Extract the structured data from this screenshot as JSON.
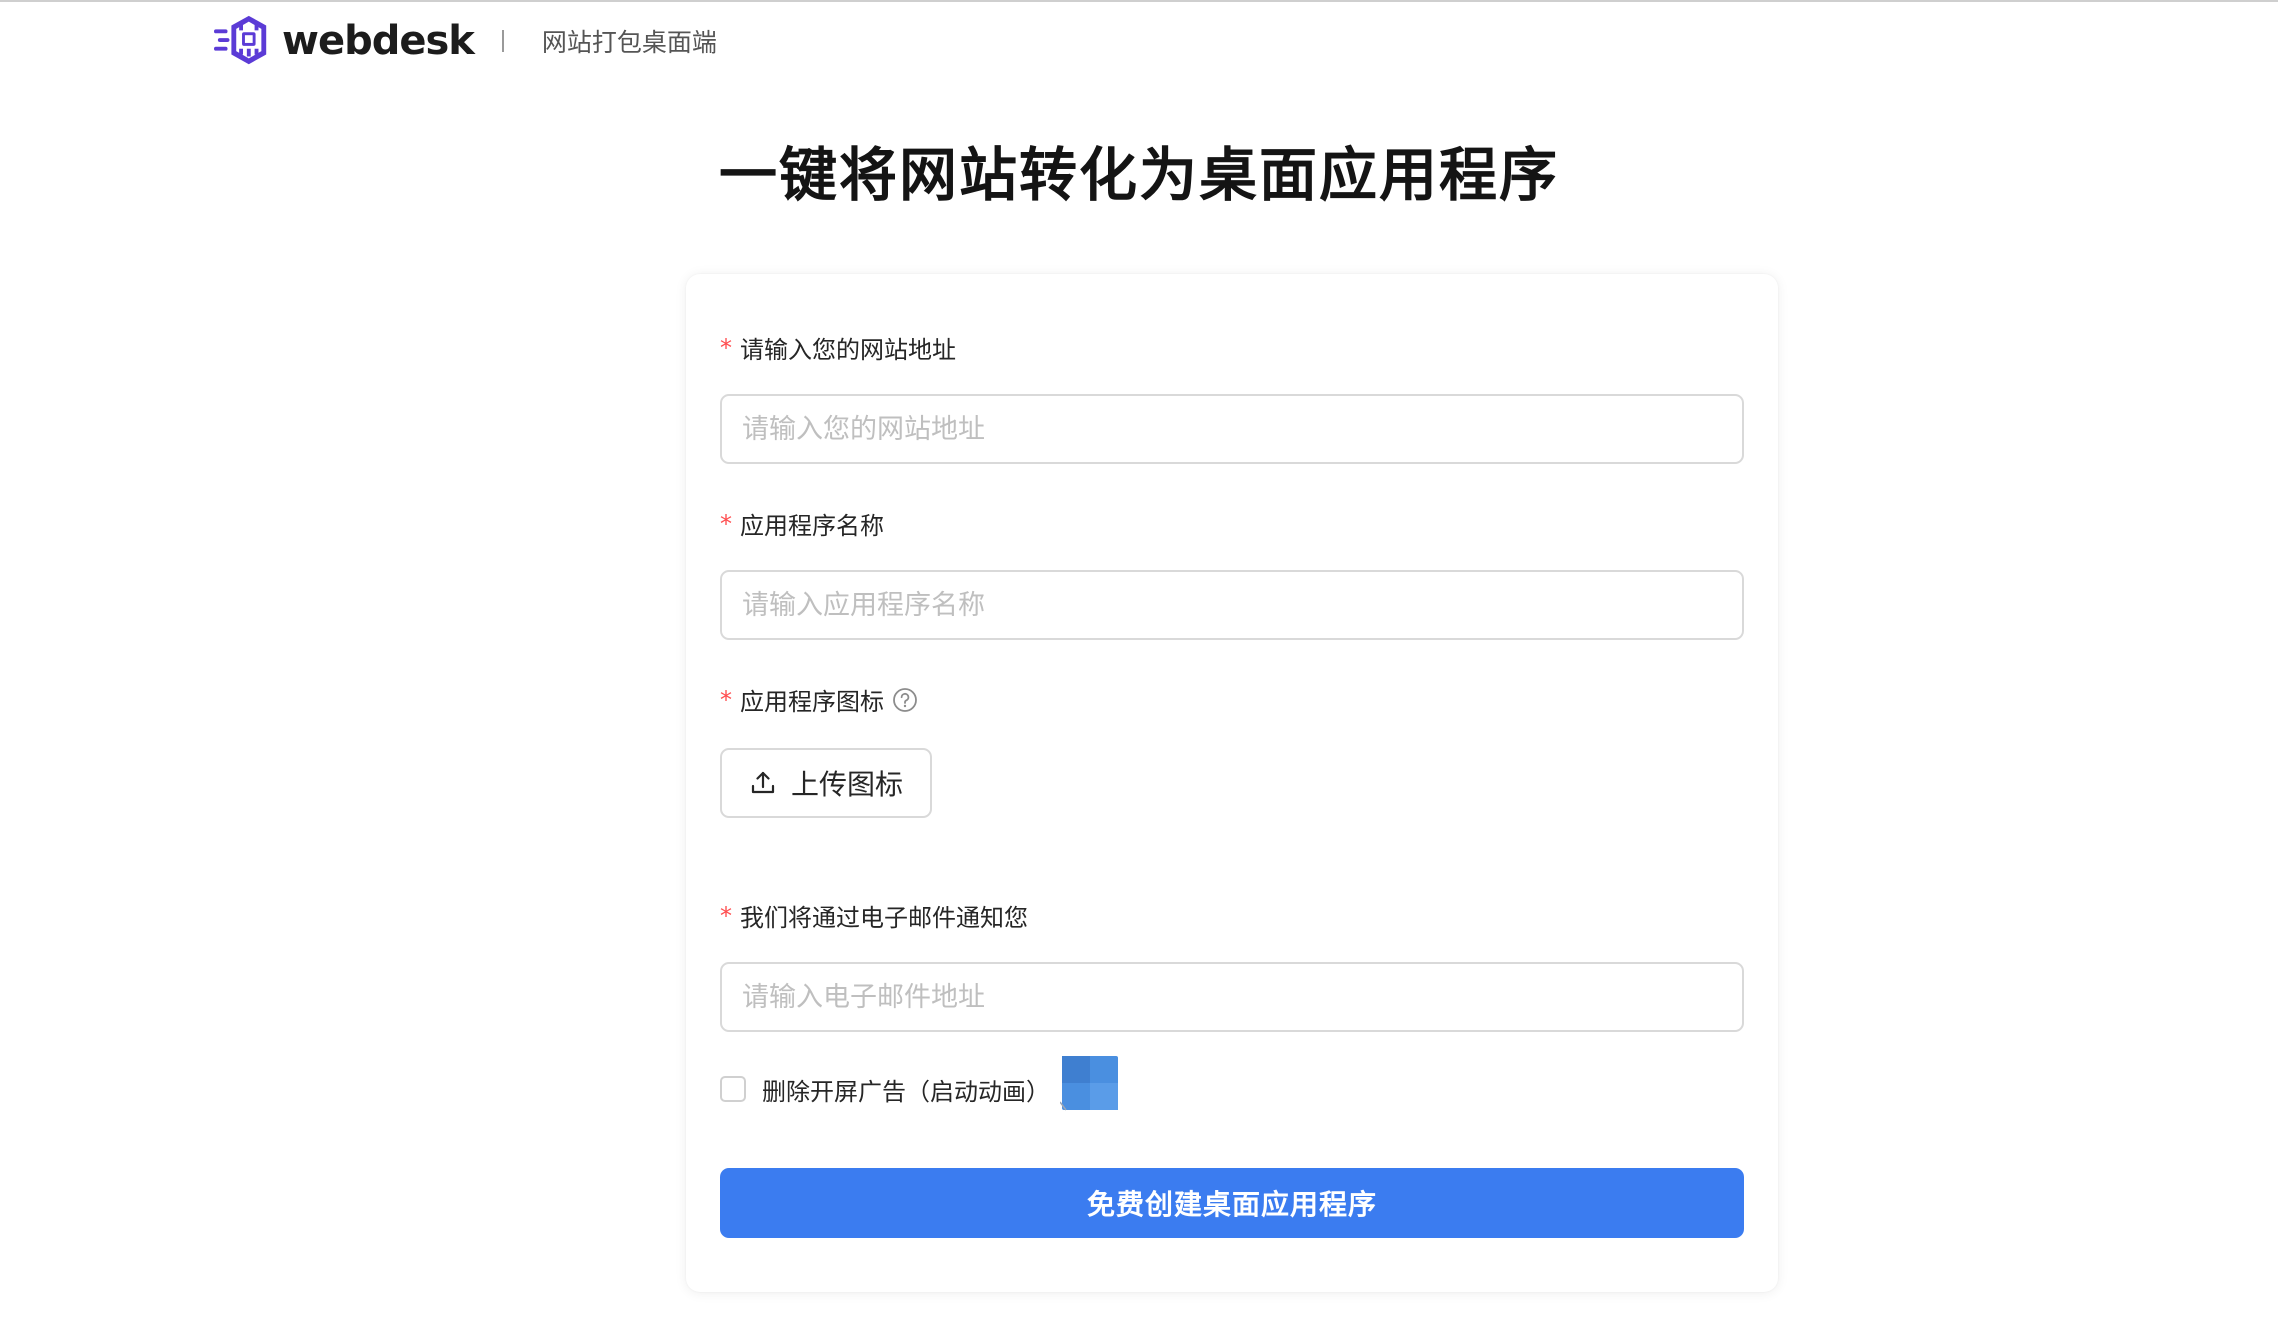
{
  "header": {
    "logo_text": "webdesk",
    "tagline": "网站打包桌面端"
  },
  "headline": "一键将网站转化为桌面应用程序",
  "form": {
    "required_mark": "*",
    "website": {
      "label": "请输入您的网站地址",
      "placeholder": "请输入您的网站地址",
      "value": ""
    },
    "app_name": {
      "label": "应用程序名称",
      "placeholder": "请输入应用程序名称",
      "value": ""
    },
    "app_icon": {
      "label": "应用程序图标",
      "help_icon": "question-circle-icon",
      "upload_label": "上传图标",
      "upload_icon": "upload-icon"
    },
    "email": {
      "label": "我们将通过电子邮件通知您",
      "placeholder": "请输入电子邮件地址",
      "value": ""
    },
    "remove_ads": {
      "label": "删除开屏广告（启动动画）",
      "checked": false
    },
    "submit_label": "免费创建桌面应用程序"
  },
  "colors": {
    "primary": "#3b7cf0",
    "required": "#ff4d4f",
    "logo_purple": "#5b3bd6"
  }
}
